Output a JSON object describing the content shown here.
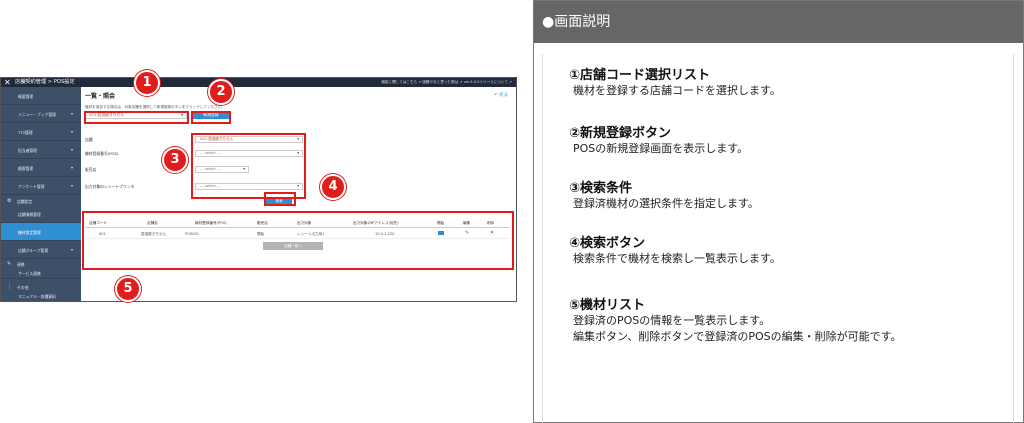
{
  "screen": {
    "topbar": {
      "close": "✕",
      "crumbs": "店舗契約管理 > POS設定",
      "links": "機能に関してはこちら ↗  困難やなと思った際は ↗  ver.5.0.0リリースについて ↗"
    },
    "sidebar": {
      "items": [
        {
          "label": "概要管理"
        },
        {
          "label": "メニュー・ブック管理",
          "arrow": "▾"
        },
        {
          "label": "TT0管理",
          "arrow": "▾"
        },
        {
          "label": "担当者管理",
          "arrow": "▾"
        },
        {
          "label": "顧客管理",
          "arrow": "▾"
        },
        {
          "label": "アンケート管理",
          "arrow": "▾"
        }
      ],
      "group1": {
        "icon": "⚙",
        "label": "店舗設定"
      },
      "store_items": [
        {
          "label": "店舗情報管理"
        },
        {
          "label": "機材設定管理",
          "active": true
        },
        {
          "label": "店舗グループ管理",
          "arrow": "▾"
        }
      ],
      "group2": {
        "icon": "✎",
        "label": "連携"
      },
      "service_item": {
        "label": "サービス連携"
      },
      "group3": {
        "icon": "⋮",
        "label": "その他"
      },
      "manual_item": {
        "label": "マニュアル・各種資料"
      }
    },
    "main": {
      "title": "一覧・照会",
      "back": "↶ 戻る",
      "description": "機材を追加する場合は、対象店舗を選択して新規登録ボタンをクリックしてください。",
      "store_select": "001:居酒屋きちせん",
      "new_button": "新規登録",
      "fields": [
        {
          "label": "店舗",
          "value": "001:居酒屋きちせん"
        },
        {
          "label": "機材登録番号(POS)",
          "value": "--- select ---"
        },
        {
          "label": "販売店",
          "value": "--- select ---"
        },
        {
          "label": "出力対象のレシートプリンタ",
          "value": "--- select ---"
        }
      ],
      "search_button": "検索",
      "table": {
        "headers": [
          "店舗コード",
          "店舗名",
          "機材登録番号(POS)",
          "販売店",
          "出力対象",
          "出力対象のIPアドレス(宛先)",
          "開始",
          "編集",
          "削除"
        ],
        "rows": [
          [
            "001",
            "居酒屋きちせん",
            "POS001",
            "開始",
            "レシート出力用1",
            "10.0.1.220"
          ]
        ]
      },
      "list_button": "店舗一覧へ"
    },
    "markers": [
      "1",
      "2",
      "3",
      "4",
      "5"
    ]
  },
  "panel": {
    "header": "●画面説明",
    "items": [
      {
        "title": "①店舗コード選択リスト",
        "lines": [
          "機材を登録する店舗コードを選択します。"
        ]
      },
      {
        "title": "②新規登録ボタン",
        "lines": [
          "POSの新規登録画面を表示します。"
        ]
      },
      {
        "title": "③検索条件",
        "lines": [
          "登録済機材の選択条件を指定します。"
        ]
      },
      {
        "title": "④検索ボタン",
        "lines": [
          "検索条件で機材を検索し一覧表示します。"
        ]
      },
      {
        "title": "⑤機材リスト",
        "lines": [
          "登録済のPOSの情報を一覧表示します。",
          "編集ボタン、削除ボタンで登録済のPOSの編集・削除が可能です。"
        ]
      }
    ]
  },
  "colors": {
    "highlight": "#e21b1b",
    "sidebar": "#3d5067",
    "accent": "#2f8fd0",
    "panel_header": "#666666"
  }
}
